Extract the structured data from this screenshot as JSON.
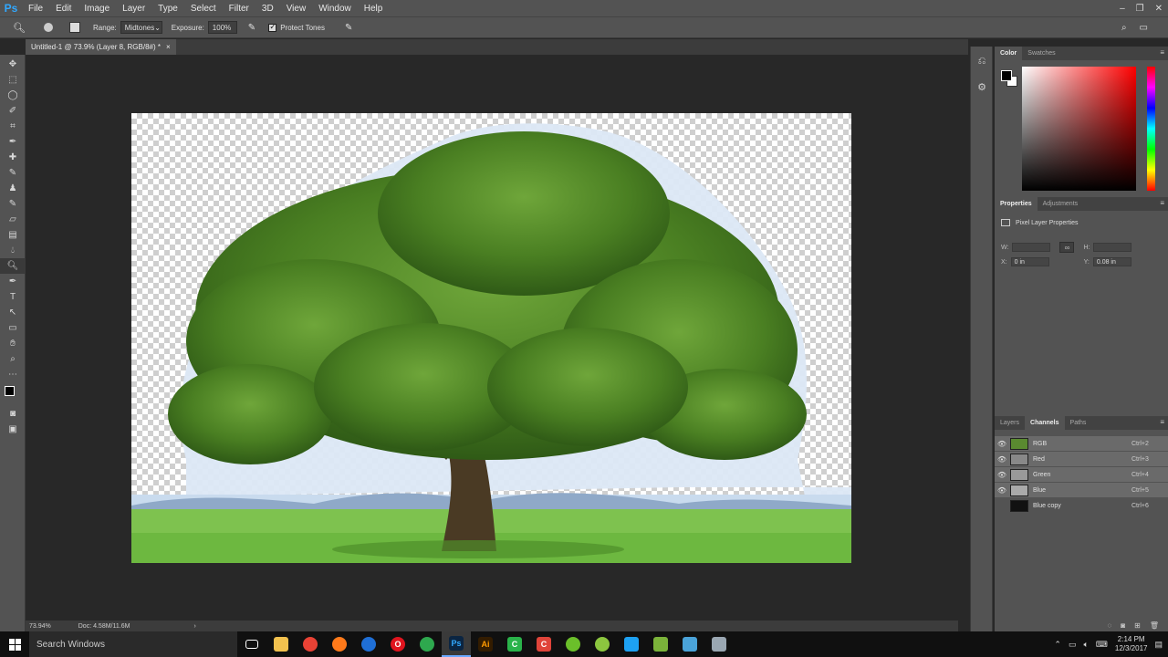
{
  "app": {
    "logo": "Ps"
  },
  "menu": [
    "File",
    "Edit",
    "Image",
    "Layer",
    "Type",
    "Select",
    "Filter",
    "3D",
    "View",
    "Window",
    "Help"
  ],
  "options": {
    "range_label": "Range:",
    "range_value": "Midtones",
    "exposure_label": "Exposure:",
    "exposure_value": "100%",
    "protect_tones_label": "Protect Tones"
  },
  "document": {
    "tab_title": "Untitled-1 @ 73.9% (Layer 8, RGB/8#) *"
  },
  "status": {
    "zoom": "73.94%",
    "doc_size": "Doc: 4.58M/11.6M"
  },
  "color_panel": {
    "tabs": [
      "Color",
      "Swatches"
    ]
  },
  "properties_panel": {
    "tabs": [
      "Properties",
      "Adjustments"
    ],
    "title": "Pixel Layer Properties",
    "w_label": "W:",
    "h_label": "H:",
    "x_label": "X:",
    "x_value": "0 in",
    "y_label": "Y:",
    "y_value": "0.08 in",
    "link_icon": "link-icon"
  },
  "channels_panel": {
    "tabs": [
      "Layers",
      "Channels",
      "Paths"
    ],
    "channels": [
      {
        "name": "RGB",
        "shortcut": "Ctrl+2",
        "visible": true,
        "selected": true
      },
      {
        "name": "Red",
        "shortcut": "Ctrl+3",
        "visible": true,
        "selected": true
      },
      {
        "name": "Green",
        "shortcut": "Ctrl+4",
        "visible": true,
        "selected": true
      },
      {
        "name": "Blue",
        "shortcut": "Ctrl+5",
        "visible": true,
        "selected": true
      },
      {
        "name": "Blue copy",
        "shortcut": "Ctrl+6",
        "visible": false,
        "selected": false
      }
    ]
  },
  "taskbar": {
    "search_placeholder": "Search Windows",
    "time": "2:14 PM",
    "date": "12/3/2017"
  },
  "colors": {
    "accent": "#31a8ff",
    "panel": "#535353",
    "canvas_bg": "#282828"
  }
}
